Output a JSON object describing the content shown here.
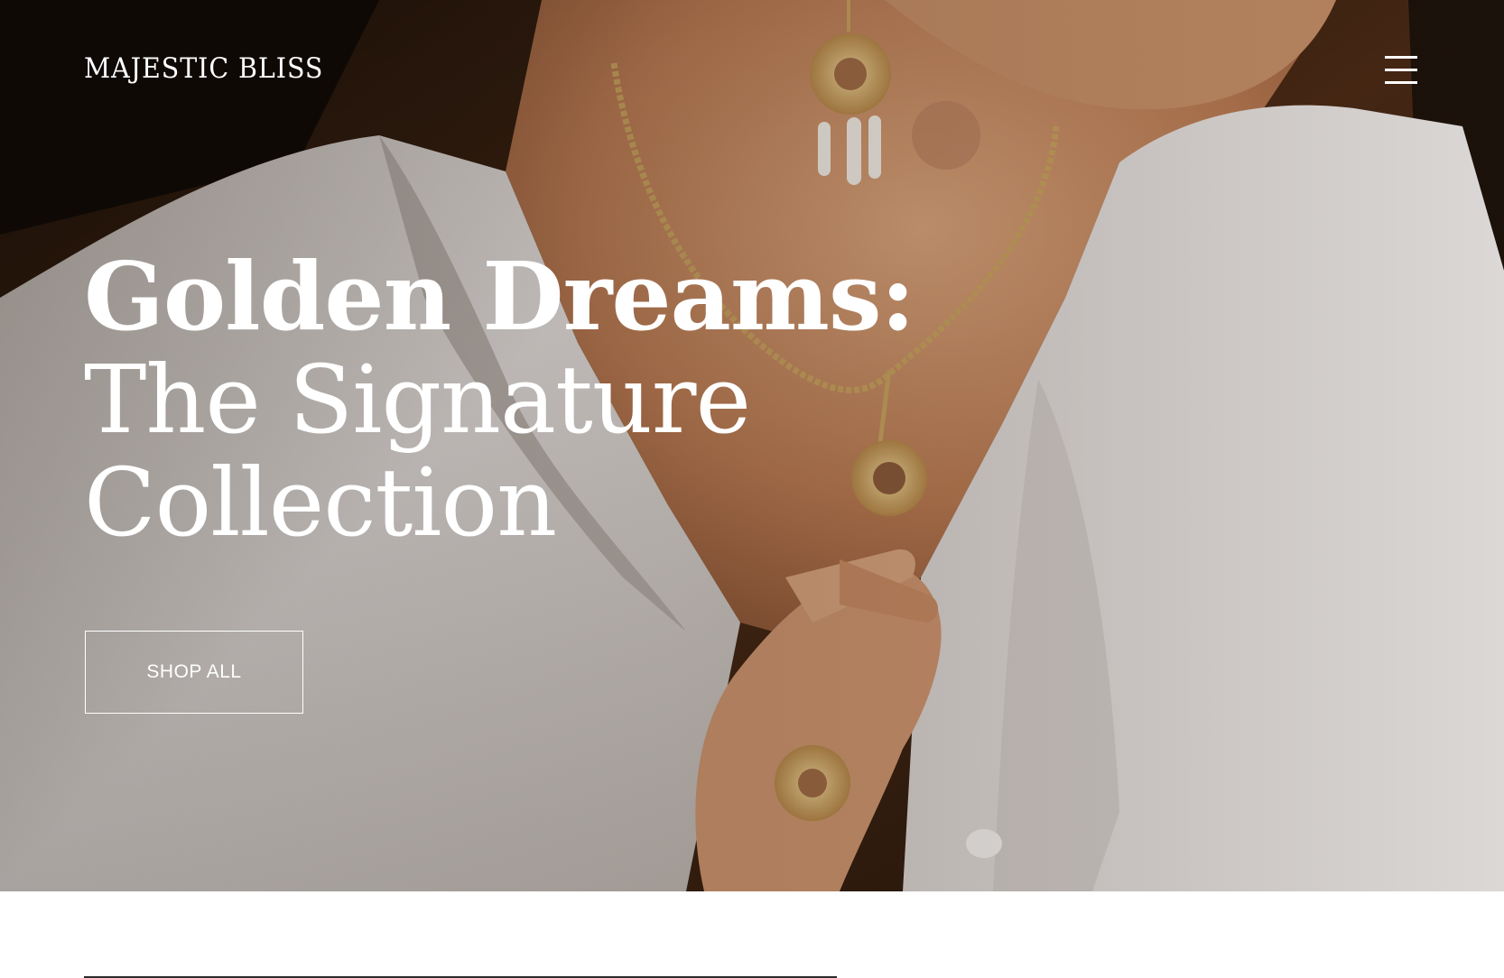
{
  "header": {
    "brand": "MAJESTIC BLISS",
    "menu_icon": "hamburger-menu-icon"
  },
  "hero": {
    "title_line_1": "Golden Dreams:",
    "title_line_2": "The Signature",
    "title_line_3": "Collection",
    "cta_label": "SHOP ALL",
    "image_subject": "woman in white linen shirt wearing gold medallion necklace, earrings and ring"
  },
  "colors": {
    "text_on_hero": "#ffffff",
    "page_background": "#ffffff",
    "divider": "#2b2b2b"
  }
}
